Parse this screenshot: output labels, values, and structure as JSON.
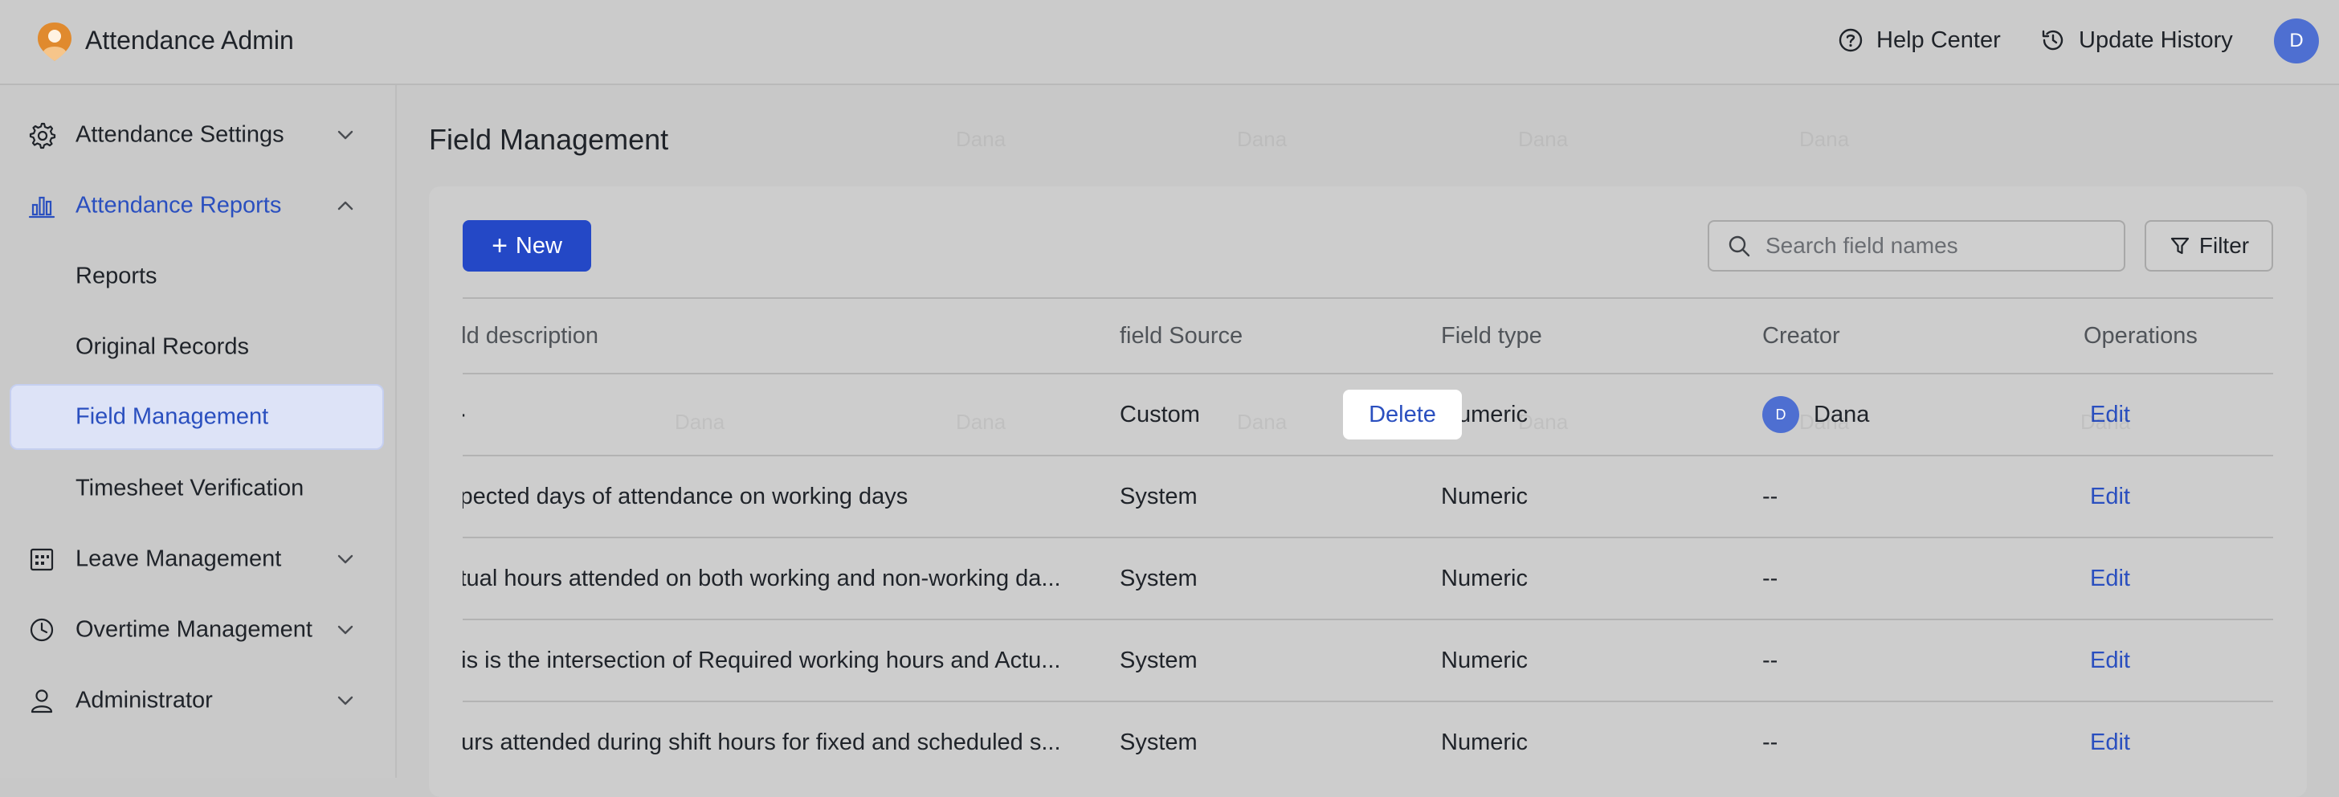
{
  "header": {
    "app_title": "Attendance Admin",
    "help_center": "Help Center",
    "update_history": "Update History",
    "avatar_initial": "D"
  },
  "sidebar": {
    "items": [
      {
        "label": "Attendance Settings",
        "icon": "gear-icon"
      },
      {
        "label": "Attendance Reports",
        "icon": "bar-chart-icon"
      },
      {
        "label": "Reports"
      },
      {
        "label": "Original Records"
      },
      {
        "label": "Field Management"
      },
      {
        "label": "Timesheet Verification"
      },
      {
        "label": "Leave Management",
        "icon": "calendar-icon"
      },
      {
        "label": "Overtime Management",
        "icon": "clock-icon"
      },
      {
        "label": "Administrator",
        "icon": "user-icon"
      }
    ]
  },
  "main": {
    "title": "Field Management",
    "new_label": "New",
    "search_placeholder": "Search field names",
    "filter_label": "Filter",
    "table": {
      "headers": [
        "eld description",
        "field Source",
        "Field type",
        "Creator",
        "Operations"
      ],
      "rows": [
        {
          "description": "·",
          "source": "Custom",
          "type": "Numeric",
          "creator": "Dana",
          "creator_initial": "D",
          "edit": "Edit",
          "delete": "Delete"
        },
        {
          "description": "xpected days of attendance on working days",
          "source": "System",
          "type": "Numeric",
          "creator": "--",
          "edit": "Edit"
        },
        {
          "description": "ctual hours attended on both working and non-working da...",
          "source": "System",
          "type": "Numeric",
          "creator": "--",
          "edit": "Edit"
        },
        {
          "description": "his is the intersection of Required working hours and Actu...",
          "source": "System",
          "type": "Numeric",
          "creator": "--",
          "edit": "Edit"
        },
        {
          "description": "ours attended during shift hours for fixed and scheduled s...",
          "source": "System",
          "type": "Numeric",
          "creator": "--",
          "edit": "Edit"
        }
      ]
    },
    "watermark": "Dana"
  },
  "colors": {
    "accent": "#2a4fbf",
    "primary_button": "#2448c6",
    "selected_bg": "#dde3f7",
    "avatar": "#4e6fd1"
  }
}
